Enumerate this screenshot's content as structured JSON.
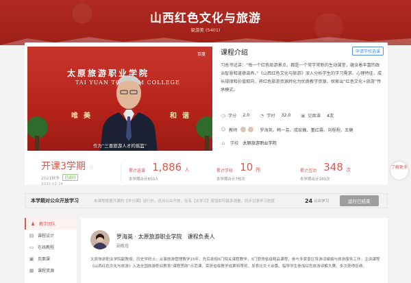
{
  "header": {
    "title": "山西红色文化与旅游",
    "subtitle": "梁游美 (5401)"
  },
  "video": {
    "logo_cn": "太原旅游职业学院",
    "logo_en": "TAI YUAN TOURISM COLLEGE",
    "slogan_left": "唯美",
    "slogan_right": "和谐",
    "caption": "作为“三晋旅游人才的摇篮”",
    "watermark": "百度"
  },
  "course": {
    "heading": "课程介绍",
    "apply_label": "申请学校选课",
    "intro": "习总书记讲：“每一个红色旅游景点，都是一个常学常新的生动课堂，蕴含着丰富的政治智慧和道德滋养。”《山西红色文化与旅游》深入分析学生的学习需求、心理特征、成长规律和价值取向，将红色旅游资源转化为优质教学资源，探索出“红色文化+旅游”传承模式。",
    "stats": [
      {
        "icon": "credit-icon",
        "label": "学分",
        "value": "2.0"
      },
      {
        "icon": "hours-icon",
        "label": "学时",
        "value": "32.0"
      },
      {
        "icon": "meeting-icon",
        "label": "见面课",
        "value": "4次"
      }
    ],
    "teachers_label": "教师",
    "teachers": "罗海英、韩一芸、成宏巍、董红霞、刘程程、王健",
    "school_label": "学校",
    "school": "太原旅游职业学院"
  },
  "semester": {
    "title": "开课3学期",
    "term": "2021秋冬",
    "status": "已运行",
    "date": "2022-01-24"
  },
  "kpis": [
    {
      "label": "累计选课",
      "value": "1,886",
      "unit": "人",
      "note": "本学期合计850人"
    },
    {
      "label": "累计学校",
      "value": "10",
      "unit": "所",
      "note": "本学期合计7校次"
    },
    {
      "label": "累计互动",
      "value": "348",
      "unit": "次",
      "note": "本学期合计180次"
    }
  ],
  "float_btn": "了解更多",
  "share": {
    "title": "本学期对公众开放学习",
    "hint": "未课程根据开课的【学分课】运行外，还对公众开放，在有【去学习】按钮即可最多观看，同步记录学习进度",
    "count": "24",
    "count_label": "公众学习",
    "button": "运行已结束"
  },
  "sidebar": {
    "items": [
      {
        "icon": "team-icon",
        "label": "教学团队",
        "active": true
      },
      {
        "icon": "design-icon",
        "label": "课程设计",
        "active": false
      },
      {
        "icon": "online-icon",
        "label": "在线教程",
        "active": false
      },
      {
        "icon": "meeting-icon",
        "label": "见面课",
        "active": false
      },
      {
        "icon": "resource-icon",
        "label": "课程资源",
        "active": false
      }
    ]
  },
  "teacher_card": {
    "name": "罗海英 · 太原旅游职业学院",
    "role": "课程负责人",
    "title": "副教授",
    "bio": "太原旅游职业学院副教授，历史学硕士。从事旅游管理教学15年，先后承担6门相关课程教学，3门获得省级精品课程，参与多家景区导游词编撰与旅游服务工作，主讲课程《山西红色文化与旅游》入选全国旅游职业教育“课程思政”示范课，荣获省级教学成果特等奖，发表论文十余篇，指导学生参加红色旅游讲解大赛，多次获得佳绩。"
  },
  "colors": {
    "brand_red": "#a9241c",
    "accent": "#e0544a",
    "link_blue": "#4f8ee0"
  }
}
